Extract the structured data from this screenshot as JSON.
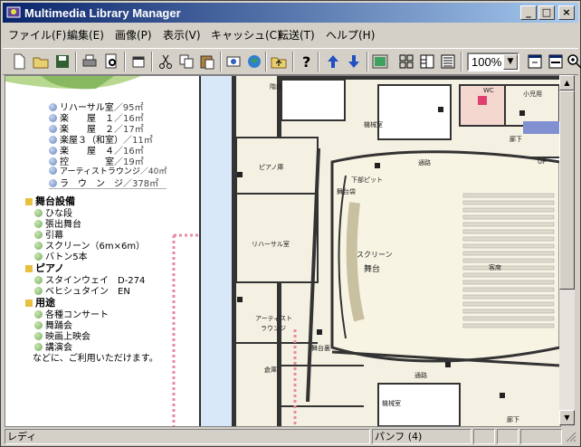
{
  "window": {
    "title": "Multimedia Library Manager"
  },
  "menu": [
    "ファイル(F)",
    "編集(E)",
    "画像(P)",
    "表示(V)",
    "キャッシュ(C)",
    "転送(T)",
    "ヘルプ(H)"
  ],
  "toolbar": {
    "zoom": "100%"
  },
  "left": {
    "rooms": [
      {
        "name": "リハーサル室",
        "area": "／95㎡"
      },
      {
        "name": "楽　　屋　１",
        "area": "／16㎡"
      },
      {
        "name": "楽　　屋　２",
        "area": "／17㎡"
      },
      {
        "name": "楽屋３（和室）",
        "area": "／11㎡"
      },
      {
        "name": "楽　　屋　４",
        "area": "／16㎡"
      },
      {
        "name": "控　　　　室",
        "area": "／19㎡"
      },
      {
        "name": "アーティストラウンジ",
        "area": "／40㎡"
      },
      {
        "name": "ラ　ウ　ン　ジ",
        "area": "／378㎡"
      }
    ],
    "sections": [
      {
        "title": "舞台設備",
        "items": [
          "ひな段",
          "張出舞台",
          "引幕",
          "スクリーン（6m×6m）",
          "バトン5本"
        ]
      },
      {
        "title": "ピアノ",
        "items": [
          "スタインウェイ　D-274",
          "ベヒシュタイン　EN"
        ]
      },
      {
        "title": "用途",
        "items": [
          "各種コンサート",
          "舞踊会",
          "映画上映会",
          "講演会"
        ]
      }
    ],
    "footer": "などに、ご利用いただけます。"
  },
  "plan": {
    "labels": {
      "stairs": "階段",
      "machine": "機械室",
      "wc": "WC",
      "childroom": "小児用",
      "corridor1": "廊下",
      "up": "UP",
      "piano": "ピアノ庫",
      "lowerpit": "下部ピット",
      "corridor2": "通路",
      "stagestore": "舞台袋",
      "rehearsal": "リハーサル室",
      "screen": "スクリーン",
      "stage": "舞台",
      "seats": "客席",
      "artist": "アーティスト ラウンジ",
      "backstage": "舞台裏",
      "green": "倉庫",
      "corridor3": "通路",
      "machine2": "機械室",
      "corridor4": "廊下"
    }
  },
  "status": {
    "ready": "レディ",
    "page": "パンフ (4)"
  }
}
